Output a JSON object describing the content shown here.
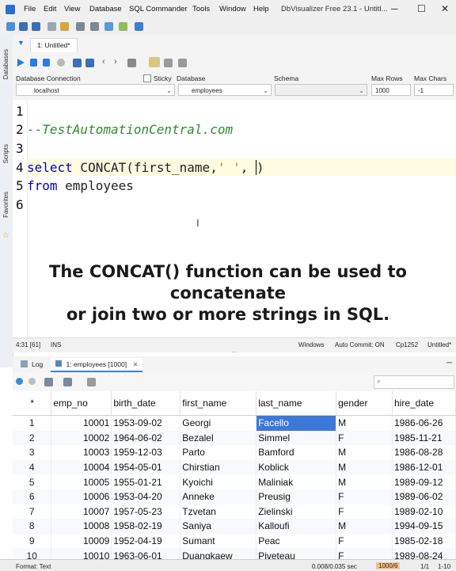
{
  "menu": {
    "items": [
      "File",
      "Edit",
      "View",
      "Database",
      "SQL Commander",
      "Tools",
      "Window",
      "Help"
    ],
    "app_title": "DbVisualizer Free 23.1 - Untitl..."
  },
  "side_tabs": {
    "databases": "Databases",
    "scripts": "Scripts",
    "favorites": "Favorites"
  },
  "editor_tab": {
    "label": "1: Untitled*"
  },
  "connection": {
    "db_conn_label": "Database Connection",
    "sticky_label": "Sticky",
    "database_label": "Database",
    "schema_label": "Schema",
    "maxrows_label": "Max Rows",
    "maxchars_label": "Max Chars",
    "conn_value": "localhost",
    "database_value": "employees",
    "schema_value": "",
    "maxrows_value": "1000",
    "maxchars_value": "-1"
  },
  "editor": {
    "line_numbers": [
      "1",
      "2",
      "3",
      "4",
      "5",
      "6"
    ],
    "line2": "--TestAutomationCentral.com",
    "line4_kw": "select",
    "line4_rest": " CONCAT(first_name,",
    "line4_str": "' '",
    "line4_end": ", ",
    "line5_kw": "from",
    "line5_rest": " employees"
  },
  "caption": {
    "line1": "The CONCAT() function can be used to concatenate",
    "line2": "or join two or more strings in SQL."
  },
  "editor_status": {
    "position": "4:31 [61]",
    "mode": "INS",
    "line_sep": "Windows",
    "autocommit": "Auto Commit: ON",
    "encoding": "Cp1252",
    "file": "Untitled*"
  },
  "bottom_tabs": {
    "log": "Log",
    "results": "1: employees [1000]"
  },
  "grid": {
    "columns": [
      "*",
      "emp_no",
      "birth_date",
      "first_name",
      "last_name",
      "gender",
      "hire_date"
    ],
    "rows": [
      [
        "1",
        "10001",
        "1953-09-02",
        "Georgi",
        "Facello",
        "M",
        "1986-06-26"
      ],
      [
        "2",
        "10002",
        "1964-06-02",
        "Bezalel",
        "Simmel",
        "F",
        "1985-11-21"
      ],
      [
        "3",
        "10003",
        "1959-12-03",
        "Parto",
        "Bamford",
        "M",
        "1986-08-28"
      ],
      [
        "4",
        "10004",
        "1954-05-01",
        "Chirstian",
        "Koblick",
        "M",
        "1986-12-01"
      ],
      [
        "5",
        "10005",
        "1955-01-21",
        "Kyoichi",
        "Maliniak",
        "M",
        "1989-09-12"
      ],
      [
        "6",
        "10006",
        "1953-04-20",
        "Anneke",
        "Preusig",
        "F",
        "1989-06-02"
      ],
      [
        "7",
        "10007",
        "1957-05-23",
        "Tzvetan",
        "Zielinski",
        "F",
        "1989-02-10"
      ],
      [
        "8",
        "10008",
        "1958-02-19",
        "Saniya",
        "Kalloufi",
        "M",
        "1994-09-15"
      ],
      [
        "9",
        "10009",
        "1952-04-19",
        "Sumant",
        "Peac",
        "F",
        "1985-02-18"
      ],
      [
        "10",
        "10010",
        "1963-06-01",
        "Duangkaew",
        "Piveteau",
        "F",
        "1989-08-24"
      ]
    ]
  },
  "status": {
    "format": "Format: Text",
    "timing": "0.008/0.035 sec",
    "rows": "1000/6",
    "page": "1/1",
    "range": "1-10"
  }
}
